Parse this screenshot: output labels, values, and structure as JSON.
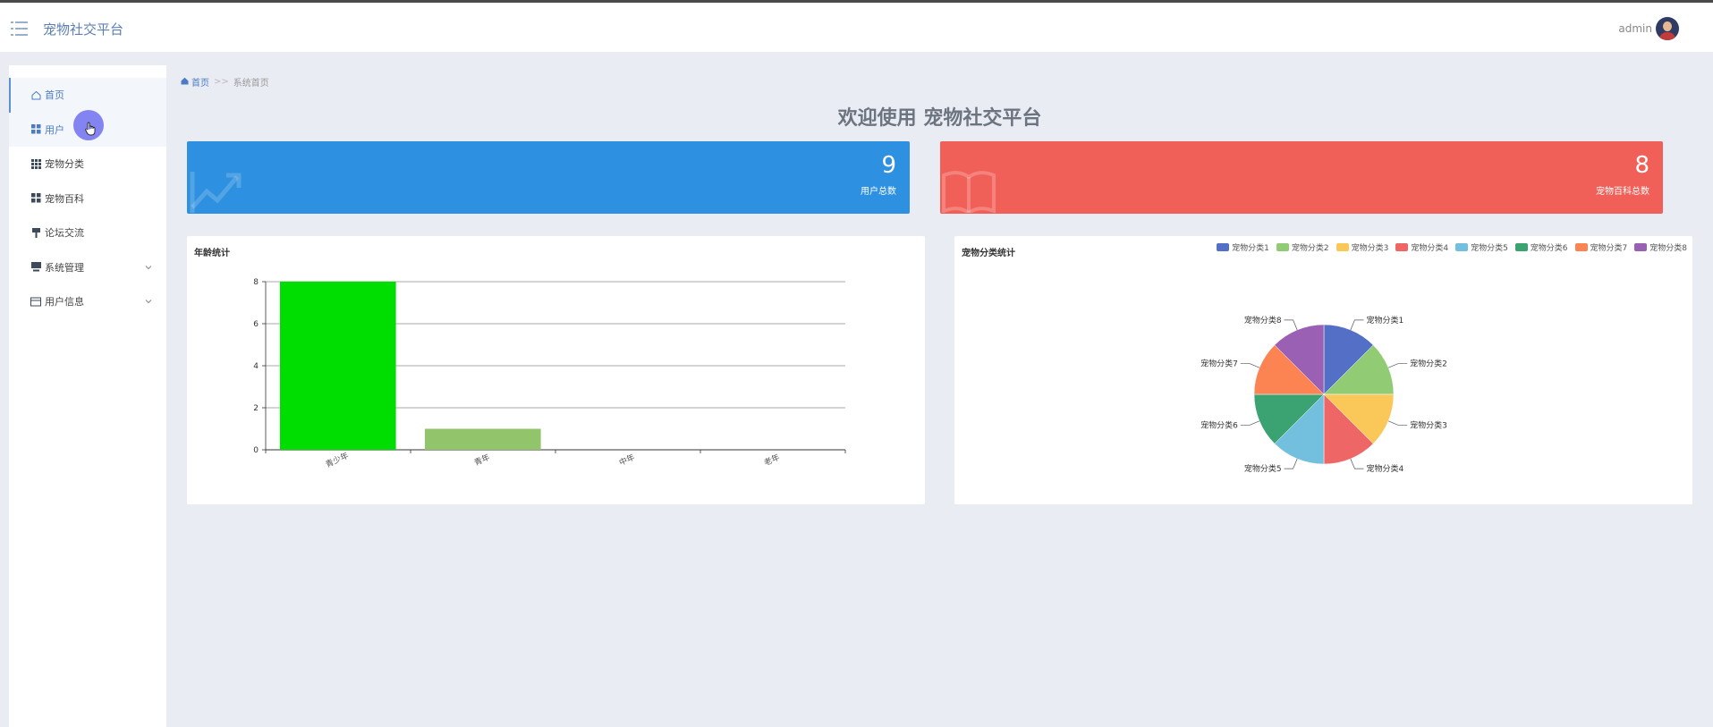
{
  "header": {
    "app_title": "宠物社交平台",
    "user_name": "admin"
  },
  "sidebar": {
    "items": [
      {
        "label": "首页",
        "icon": "home-icon"
      },
      {
        "label": "用户",
        "icon": "grid-icon"
      },
      {
        "label": "宠物分类",
        "icon": "grid9-icon"
      },
      {
        "label": "宠物百科",
        "icon": "grid-icon"
      },
      {
        "label": "论坛交流",
        "icon": "pin-icon"
      },
      {
        "label": "系统管理",
        "icon": "monitor-icon"
      },
      {
        "label": "用户信息",
        "icon": "card-icon"
      }
    ]
  },
  "breadcrumb": {
    "home": "首页",
    "separator": ">>",
    "current": "系统首页"
  },
  "welcome": "欢迎使用 宠物社交平台",
  "stats": [
    {
      "value": "9",
      "label": "用户总数",
      "color": "#2e90e0"
    },
    {
      "value": "8",
      "label": "宠物百科总数",
      "color": "#f06058"
    }
  ],
  "chart_data": [
    {
      "type": "bar",
      "title": "年龄统计",
      "categories": [
        "青少年",
        "青年",
        "中年",
        "老年"
      ],
      "values": [
        8,
        1,
        0,
        0
      ],
      "colors": [
        "#00dd00",
        "#91c46b",
        "#91c46b",
        "#91c46b"
      ],
      "ylim": [
        0,
        8
      ],
      "yticks": [
        0,
        2,
        4,
        6,
        8
      ],
      "grid": true
    },
    {
      "type": "pie",
      "title": "宠物分类统计",
      "categories": [
        "宠物分类1",
        "宠物分类2",
        "宠物分类3",
        "宠物分类4",
        "宠物分类5",
        "宠物分类6",
        "宠物分类7",
        "宠物分类8"
      ],
      "values": [
        1,
        1,
        1,
        1,
        1,
        1,
        1,
        1
      ],
      "colors": [
        "#5470c6",
        "#91cc75",
        "#fac858",
        "#ee6666",
        "#73c0de",
        "#3ba272",
        "#fc8452",
        "#9a60b4"
      ],
      "legend_position": "top-right"
    }
  ]
}
